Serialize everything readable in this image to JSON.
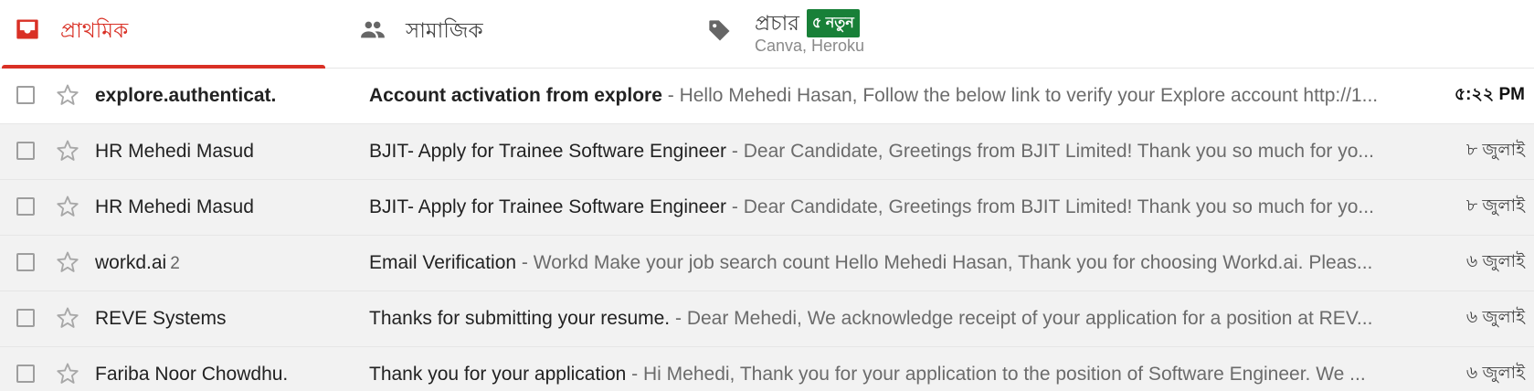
{
  "tabs": [
    {
      "label": "প্রাথমিক",
      "icon": "inbox-icon",
      "active": true
    },
    {
      "label": "সামাজিক",
      "icon": "people-icon",
      "active": false
    },
    {
      "label": "প্রচার",
      "icon": "tag-icon",
      "active": false,
      "badge": "৫ নতুন",
      "subtitle": "Canva, Heroku"
    }
  ],
  "colors": {
    "accent": "#d93025",
    "badge": "#188038"
  },
  "emails": [
    {
      "sender": "explore.authenticat.",
      "count": "",
      "subject": "Account activation from explore",
      "separator": " - ",
      "snippet": "Hello Mehedi Hasan, Follow the below link to verify your Explore account http://1...",
      "date": "৫:২২ PM",
      "unread": true
    },
    {
      "sender": "HR Mehedi Masud",
      "count": "",
      "subject": "BJIT- Apply for Trainee Software Engineer",
      "separator": " - ",
      "snippet": "Dear Candidate, Greetings from BJIT Limited! Thank you so much for yo...",
      "date": "৮ জুলাই",
      "unread": false
    },
    {
      "sender": "HR Mehedi Masud",
      "count": "",
      "subject": "BJIT- Apply for Trainee Software Engineer",
      "separator": " - ",
      "snippet": "Dear Candidate, Greetings from BJIT Limited! Thank you so much for yo...",
      "date": "৮ জুলাই",
      "unread": false
    },
    {
      "sender": "workd.ai",
      "count": "2",
      "subject": "Email Verification",
      "separator": " - ",
      "snippet": "Workd Make your job search count Hello Mehedi Hasan, Thank you for choosing Workd.ai. Pleas...",
      "date": "৬ জুলাই",
      "unread": false
    },
    {
      "sender": "REVE Systems",
      "count": "",
      "subject": "Thanks for submitting your resume.",
      "separator": " - ",
      "snippet": "Dear Mehedi, We acknowledge receipt of your application for a position at REV...",
      "date": "৬ জুলাই",
      "unread": false
    },
    {
      "sender": "Fariba Noor Chowdhu.",
      "count": "",
      "subject": "Thank you for your application",
      "separator": " - ",
      "snippet": "Hi Mehedi, Thank you for your application to the position of Software Engineer. We ...",
      "date": "৬ জুলাই",
      "unread": false
    }
  ]
}
